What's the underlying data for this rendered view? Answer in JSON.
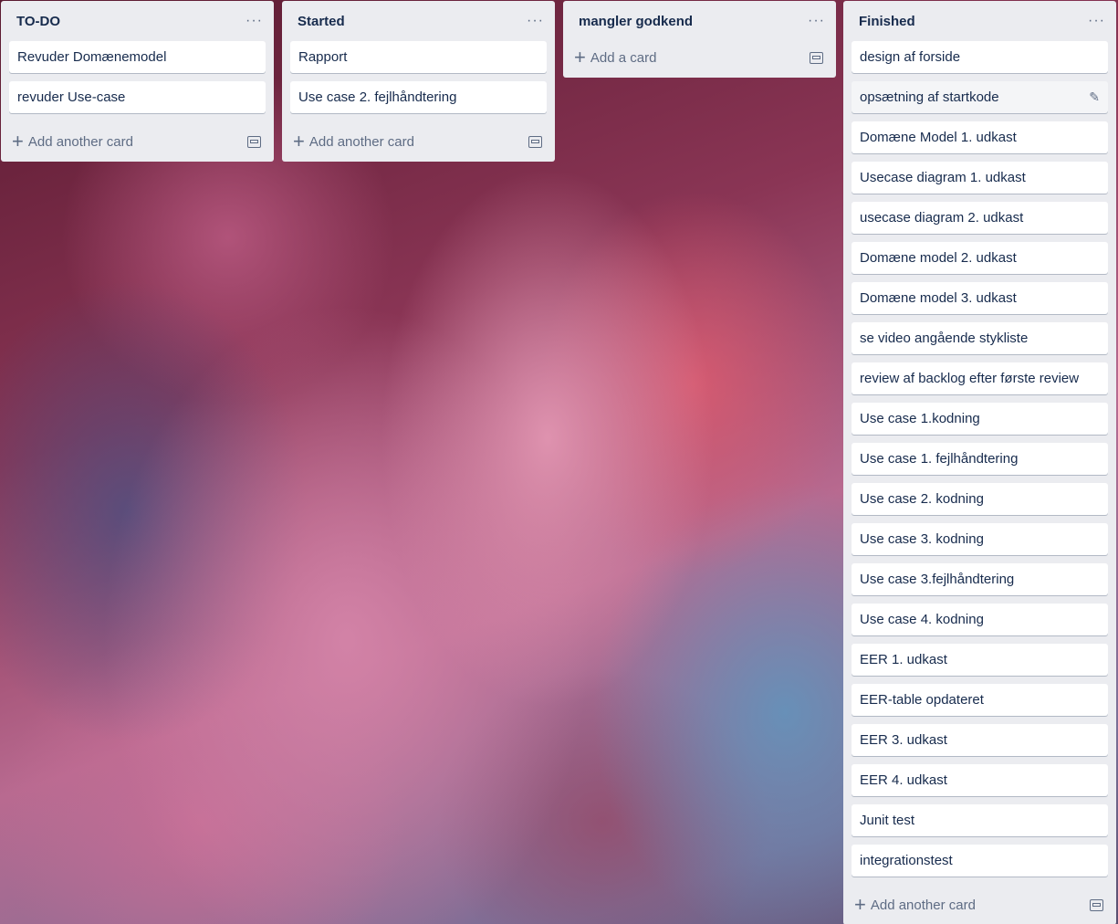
{
  "lists": [
    {
      "title": "TO-DO",
      "menu": "···",
      "cards": [
        "Revuder Domænemodel",
        "revuder Use-case"
      ],
      "add_label": "Add another card"
    },
    {
      "title": "Started",
      "menu": "···",
      "cards": [
        "Rapport",
        "Use case 2. fejlhåndtering"
      ],
      "add_label": "Add another card"
    },
    {
      "title": "mangler godkend",
      "menu": "···",
      "cards": [],
      "add_label": "Add a card"
    },
    {
      "title": "Finished",
      "menu": "···",
      "cards": [
        "design af forside",
        "opsætning af startkode",
        "Domæne Model 1. udkast",
        "Usecase diagram 1. udkast",
        "usecase diagram 2. udkast",
        "Domæne model 2. udkast",
        "Domæne model 3. udkast",
        "se video angående stykliste",
        "review af backlog efter første review",
        "Use case 1.kodning",
        "Use case 1. fejlhåndtering",
        "Use case 2. kodning",
        "Use case 3. kodning",
        "Use case 3.fejlhåndtering",
        "Use case 4. kodning",
        "EER 1. udkast",
        "EER-table opdateret",
        "EER 3. udkast",
        "EER 4. udkast",
        "Junit test",
        "integrationstest"
      ],
      "add_label": "Add another card",
      "hovered_card_index": 1
    }
  ],
  "icons": {
    "plus": "+",
    "edit": "✎",
    "template": "card-template-icon"
  }
}
